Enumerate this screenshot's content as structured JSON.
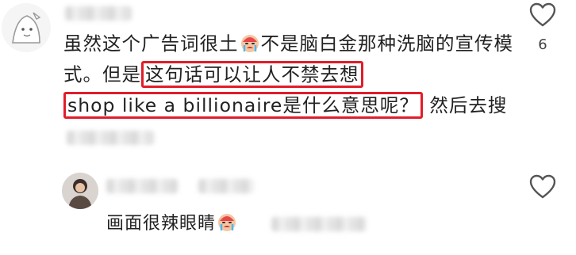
{
  "comment_main": {
    "text_before": "虽然这个广告词很土",
    "emoji_1": "crying-face-icon",
    "text_middle": "不是脑白金那种洗脑的宣传模式。但是",
    "highlight_1": "这句话可以让人不禁去想",
    "highlight_2": "shop like a billionaire是什么意思呢？",
    "text_after": " 然后去搜",
    "like_count": "6"
  },
  "reply": {
    "text": "画面很辣眼睛",
    "emoji": "crying-face-icon"
  },
  "colors": {
    "highlight_border": "#e11d2a",
    "text": "#222222",
    "icon": "#555555"
  }
}
